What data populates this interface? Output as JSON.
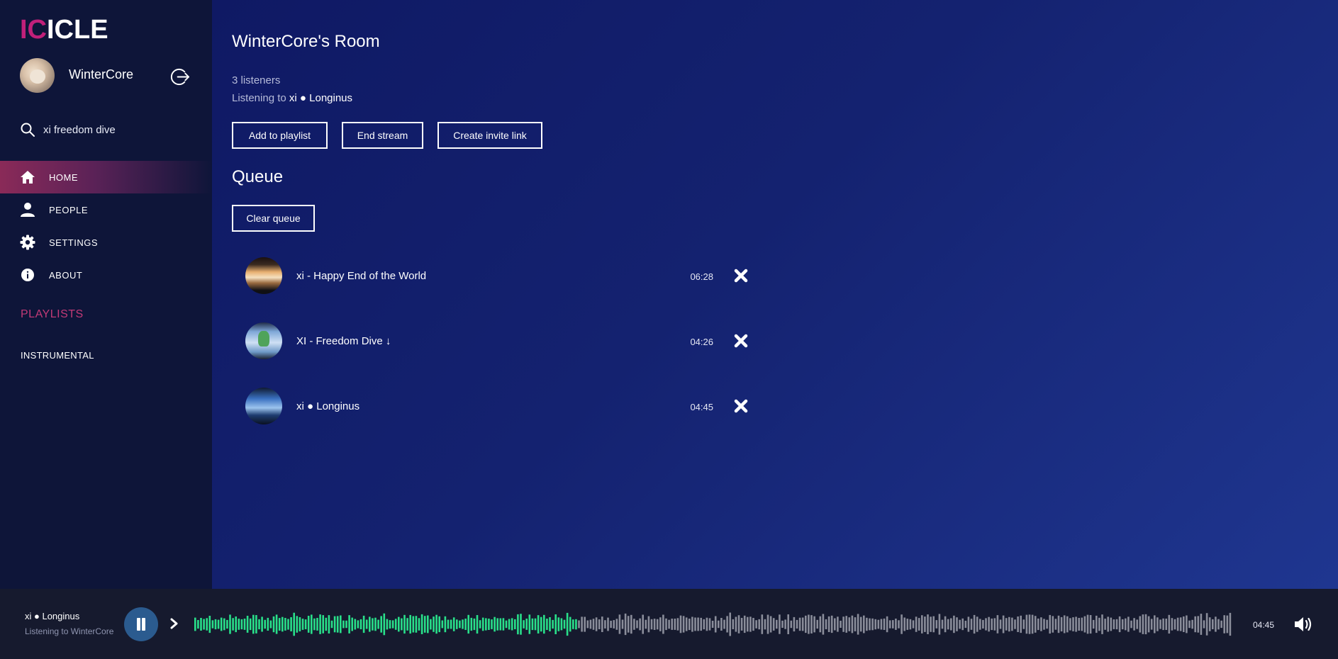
{
  "app": {
    "logo_part1": "IC",
    "logo_part2": "ICLE"
  },
  "user": {
    "name": "WinterCore"
  },
  "search": {
    "value": "xi freedom dive"
  },
  "nav": [
    {
      "label": "HOME",
      "icon": "home-icon",
      "active": true
    },
    {
      "label": "PEOPLE",
      "icon": "person-icon",
      "active": false
    },
    {
      "label": "SETTINGS",
      "icon": "gear-icon",
      "active": false
    },
    {
      "label": "ABOUT",
      "icon": "info-icon",
      "active": false
    }
  ],
  "playlists": {
    "title": "PLAYLISTS",
    "items": [
      "INSTRUMENTAL"
    ]
  },
  "room": {
    "title": "WinterCore's Room",
    "listeners": "3 listeners",
    "listening_prefix": "Listening to",
    "listening_track": "xi ● Longinus"
  },
  "buttons": {
    "add_to_playlist": "Add to playlist",
    "end_stream": "End stream",
    "create_invite": "Create invite link",
    "clear_queue": "Clear queue"
  },
  "queue": {
    "title": "Queue",
    "items": [
      {
        "title": "xi - Happy End of the World",
        "duration": "06:28"
      },
      {
        "title": "XI - Freedom Dive ↓",
        "duration": "04:26"
      },
      {
        "title": "xi ● Longinus",
        "duration": "04:45"
      }
    ]
  },
  "player": {
    "track": "xi ● Longinus",
    "subtitle": "Listening to WinterCore",
    "time": "04:45",
    "progress": 0.37,
    "colors": {
      "played": "#29e08a",
      "unplayed": "#8a8d9a",
      "button": "#2b5b8f"
    }
  },
  "colors": {
    "accent": "#c1207a",
    "playlists_title": "#c33a77",
    "sidebar_bg": "#0e1539"
  }
}
